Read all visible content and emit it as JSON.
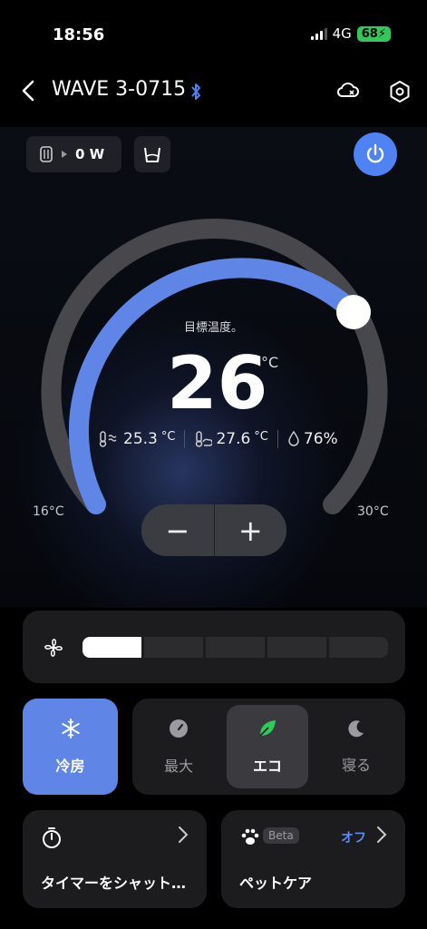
{
  "status_bar": {
    "time": "18:56",
    "network": "4G",
    "battery": "68"
  },
  "header": {
    "title": "WAVE 3-0715"
  },
  "top_controls": {
    "power_watts": "0 W"
  },
  "thermostat": {
    "label": "目標温度。",
    "target": "26",
    "unit": "°C",
    "min_label": "16°C",
    "max_label": "30°C",
    "min": 16,
    "max": 30,
    "target_value": 26
  },
  "readings": {
    "indoor_temp": "25.3",
    "indoor_unit": "°C",
    "outdoor_temp": "27.6",
    "outdoor_unit": "°C",
    "humidity": "76%"
  },
  "stepper": {
    "minus": "−",
    "plus": "+"
  },
  "fan": {
    "level": 1,
    "levels": 5
  },
  "modes": {
    "cool": "冷房",
    "max": "最大",
    "eco": "エコ",
    "sleep": "寝る"
  },
  "cards": {
    "timer_title": "タイマーをシャットダウン",
    "pet_title": "ペットケア",
    "beta": "Beta",
    "pet_status": "オフ"
  },
  "colors": {
    "accent": "#5f86e6",
    "power": "#4f82f2",
    "battery": "#34c759"
  }
}
